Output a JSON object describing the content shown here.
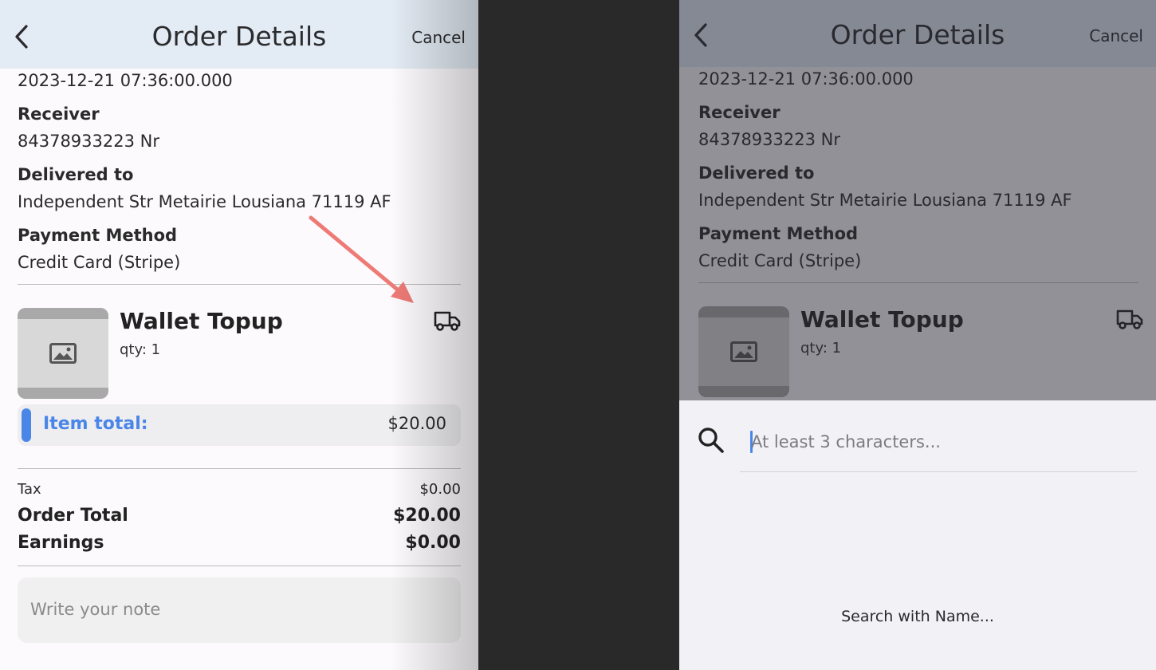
{
  "header": {
    "title": "Order Details",
    "cancel_label": "Cancel",
    "back_icon": "chevron-left-icon"
  },
  "order": {
    "date": "2023-12-21 07:36:00.000",
    "receiver_label": "Receiver",
    "receiver": "84378933223 Nr",
    "delivered_label": "Delivered to",
    "address": "Independent Str Metairie Lousiana 71119 AF",
    "payment_label": "Payment Method",
    "payment": "Credit Card (Stripe)"
  },
  "item": {
    "name": "Wallet Topup",
    "qty": "qty: 1",
    "image_icon": "image-placeholder-icon",
    "status_icon": "truck-icon"
  },
  "item_total": {
    "label": "Item total:",
    "value": "$20.00"
  },
  "summary": {
    "tax_label": "Tax",
    "tax": "$0.00",
    "order_total_label": "Order Total",
    "order_total": "$20.00",
    "earnings_label": "Earnings",
    "earnings": "$0.00"
  },
  "note": {
    "placeholder": "Write your note"
  },
  "search": {
    "placeholder": "At least 3 characters...",
    "hint": "Search with Name..."
  },
  "colors": {
    "accent": "#4a86e8",
    "header_bg": "#e3ebf4",
    "annotation_arrow": "#ee7a76"
  }
}
